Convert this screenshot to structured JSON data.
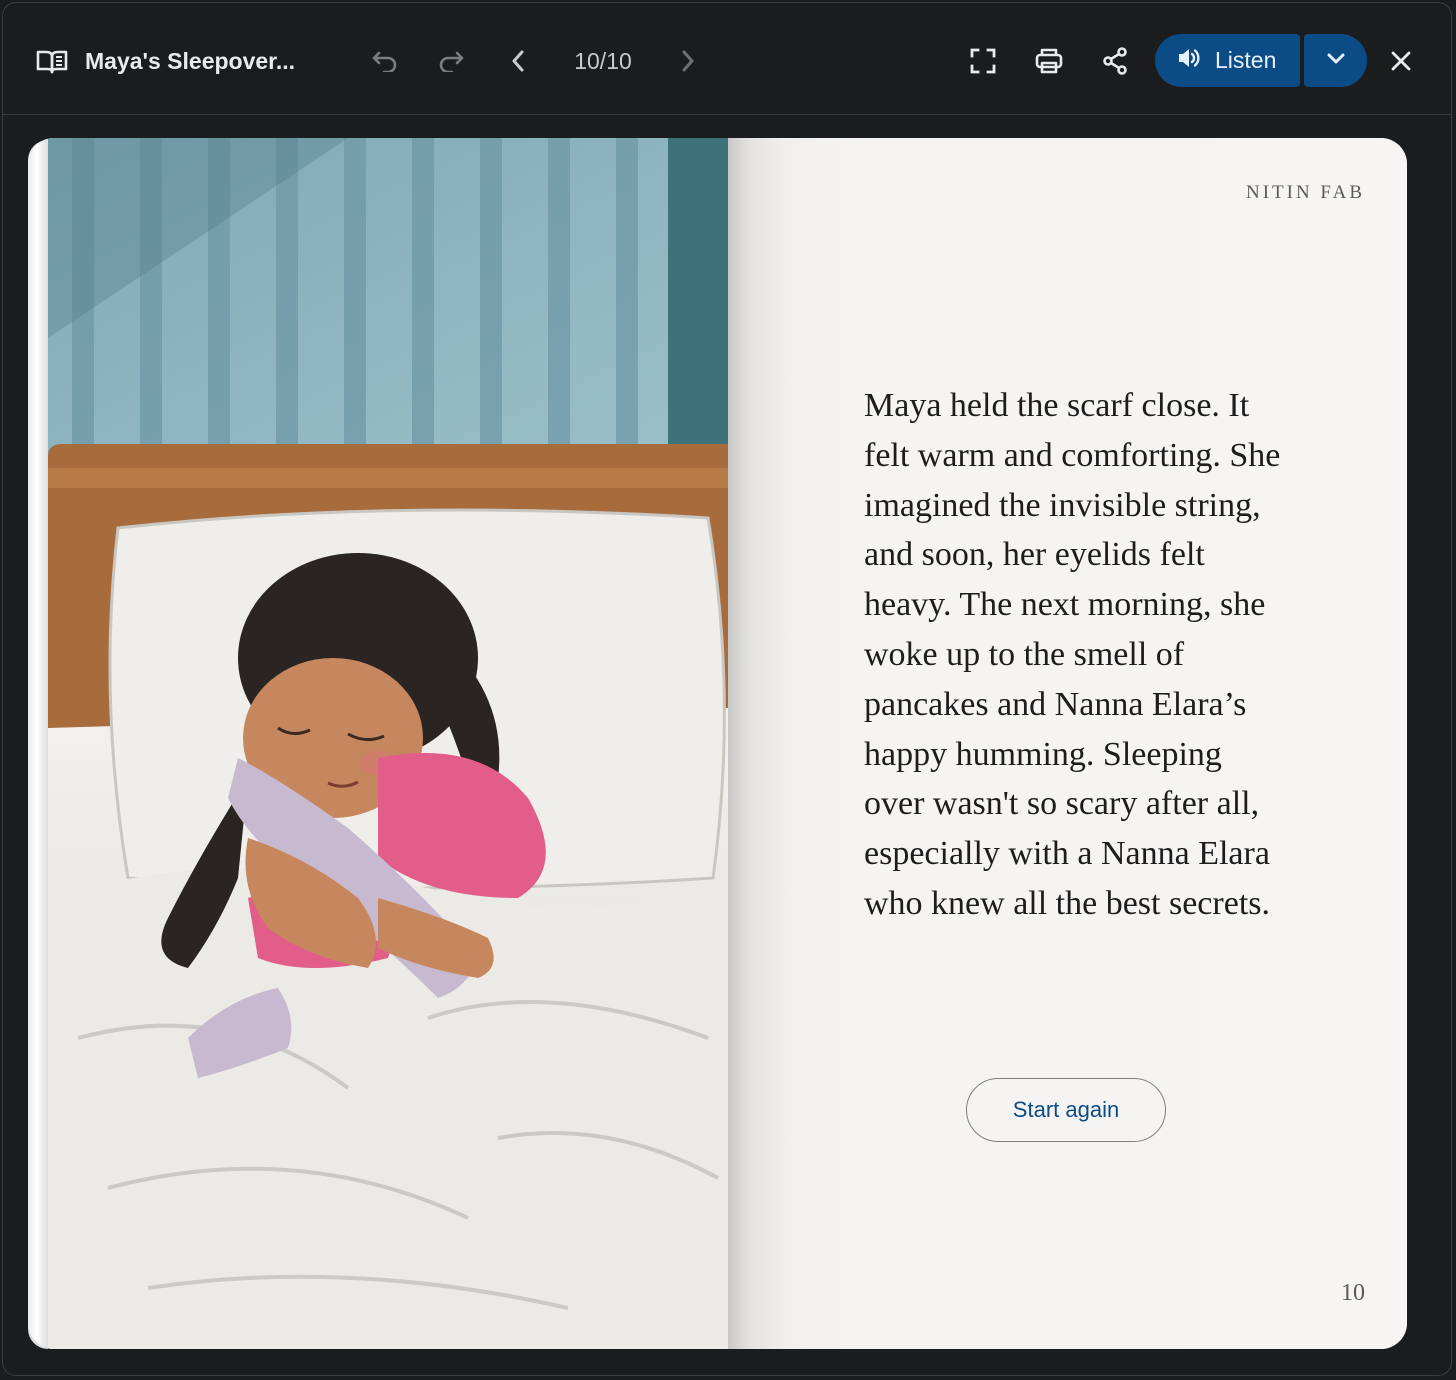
{
  "toolbar": {
    "title": "Maya's Sleepover...",
    "page_indicator": "10/10",
    "listen_label": "Listen",
    "icons": {
      "book": "book-open-icon",
      "undo": "undo-icon",
      "redo": "redo-icon",
      "prev": "chevron-left-icon",
      "next": "chevron-right-icon",
      "fullscreen": "fullscreen-icon",
      "print": "print-icon",
      "share": "share-icon",
      "speaker": "volume-icon",
      "dropdown": "chevron-down-icon",
      "close": "close-icon"
    }
  },
  "page": {
    "author": "NITIN FAB",
    "story_text": "Maya held the scarf close. It felt warm and comforting. She imagined the invisible string, and soon, her eyelids felt heavy. The next morning, she woke up to the smell of pancakes and Nanna Elara’s happy humming. Sleeping over wasn't so scary after all, especially with a Nanna Elara who knew all the best secrets.",
    "start_again_label": "Start again",
    "page_number": "10"
  },
  "colors": {
    "background": "#1b1c1e",
    "accent": "#0b4c86",
    "toolbar_text": "#e8eaed",
    "paper": "#f5f4f2"
  }
}
